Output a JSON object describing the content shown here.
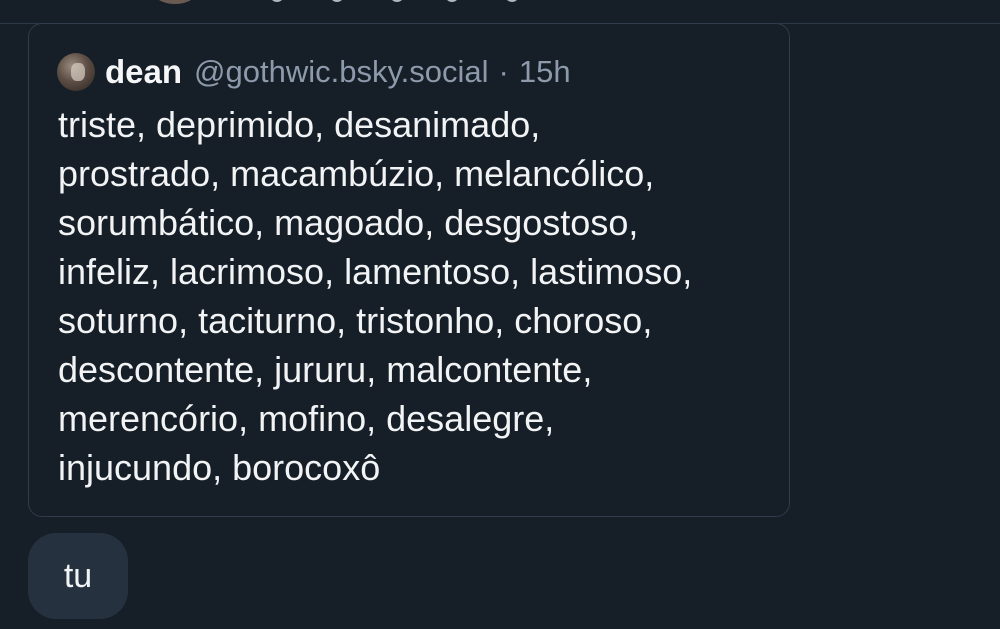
{
  "quote": {
    "author_name": "dean",
    "author_handle": "@gothwic.bsky.social",
    "separator": "·",
    "time": "15h",
    "lines": [
      "triste, deprimido, desanimado,",
      "prostrado, macambúzio, melancólico,",
      "sorumbático, magoado, desgostoso,",
      "infeliz, lacrimoso, lamentoso, lastimoso,",
      "soturno, taciturno, tristonho, choroso,",
      "descontente, jururu, malcontente,",
      "merencório, mofino, desalegre,",
      "injucundo, borocoxô"
    ]
  },
  "reply": {
    "text": "tu"
  }
}
